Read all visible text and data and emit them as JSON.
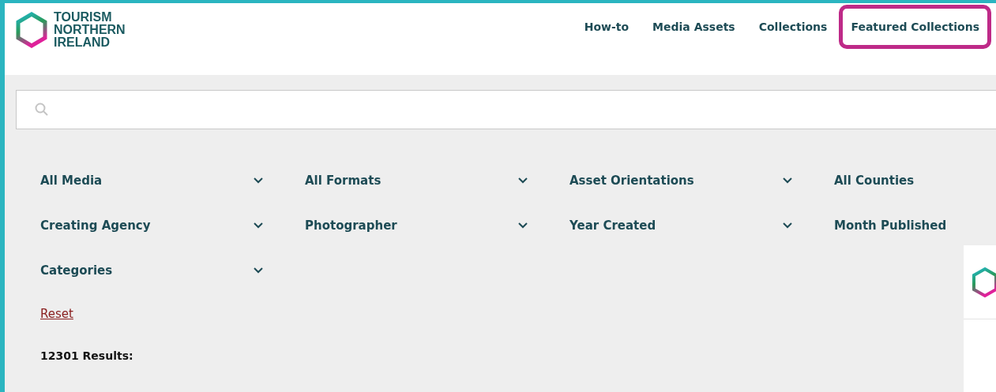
{
  "logo": {
    "lines": [
      "TOURISM",
      "NORTHERN",
      "IRELAND"
    ]
  },
  "nav": [
    {
      "label": "How-to",
      "highlighted": false
    },
    {
      "label": "Media Assets",
      "highlighted": false
    },
    {
      "label": "Collections",
      "highlighted": false
    },
    {
      "label": "Featured Collections",
      "highlighted": true
    }
  ],
  "filters": [
    {
      "label": "All Media"
    },
    {
      "label": "All Formats"
    },
    {
      "label": "Asset Orientations"
    },
    {
      "label": "All Counties"
    },
    {
      "label": "Creating Agency"
    },
    {
      "label": "Photographer"
    },
    {
      "label": "Year Created"
    },
    {
      "label": "Month Published"
    },
    {
      "label": "Categories"
    }
  ],
  "reset": "Reset",
  "results": "12301 Results:"
}
